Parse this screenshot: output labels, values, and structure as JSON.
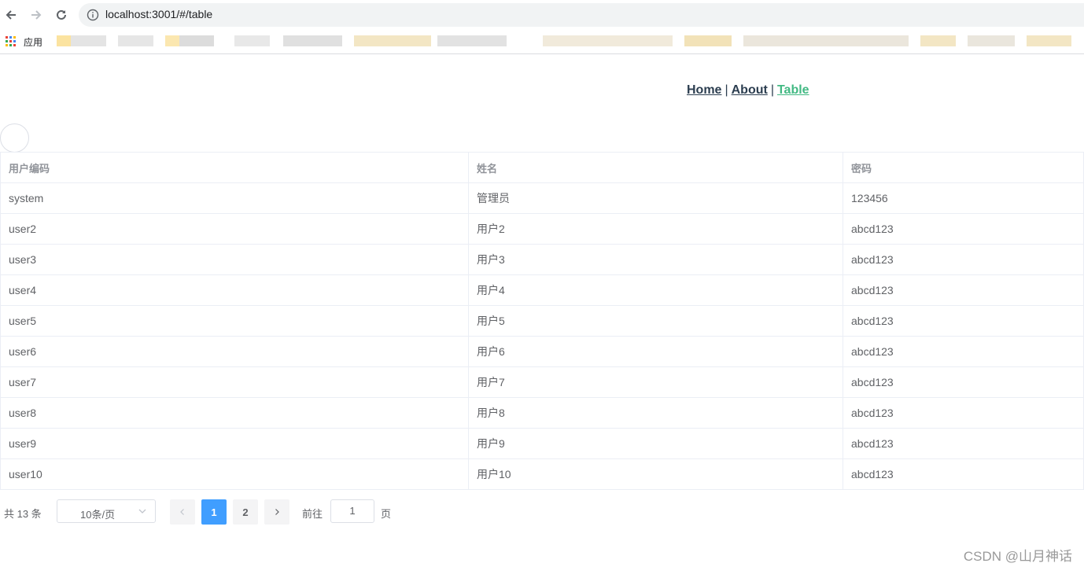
{
  "browser": {
    "url": "localhost:3001/#/table",
    "bookmarks_label": "应用"
  },
  "nav": {
    "home": "Home",
    "about": "About",
    "table": "Table",
    "separator": "|"
  },
  "table": {
    "headers": [
      "用户编码",
      "姓名",
      "密码"
    ],
    "rows": [
      [
        "system",
        "管理员",
        "123456"
      ],
      [
        "user2",
        "用户2",
        "abcd123"
      ],
      [
        "user3",
        "用户3",
        "abcd123"
      ],
      [
        "user4",
        "用户4",
        "abcd123"
      ],
      [
        "user5",
        "用户5",
        "abcd123"
      ],
      [
        "user6",
        "用户6",
        "abcd123"
      ],
      [
        "user7",
        "用户7",
        "abcd123"
      ],
      [
        "user8",
        "用户8",
        "abcd123"
      ],
      [
        "user9",
        "用户9",
        "abcd123"
      ],
      [
        "user10",
        "用户10",
        "abcd123"
      ]
    ]
  },
  "pagination": {
    "total": "共 13 条",
    "page_size": "10条/页",
    "pages": [
      "1",
      "2"
    ],
    "current_page": "1",
    "goto_label": "前往",
    "goto_value": "1",
    "goto_suffix": "页"
  },
  "watermark": "CSDN @山月神话",
  "colors": {
    "active_link": "#42b983",
    "primary": "#409eff",
    "text": "#606266",
    "header_text": "#909399"
  },
  "icons": [
    "back-arrow-icon",
    "forward-arrow-icon",
    "reload-icon",
    "info-icon",
    "apps-grid-icon",
    "chevron-down-icon",
    "chevron-left-icon",
    "chevron-right-icon"
  ]
}
